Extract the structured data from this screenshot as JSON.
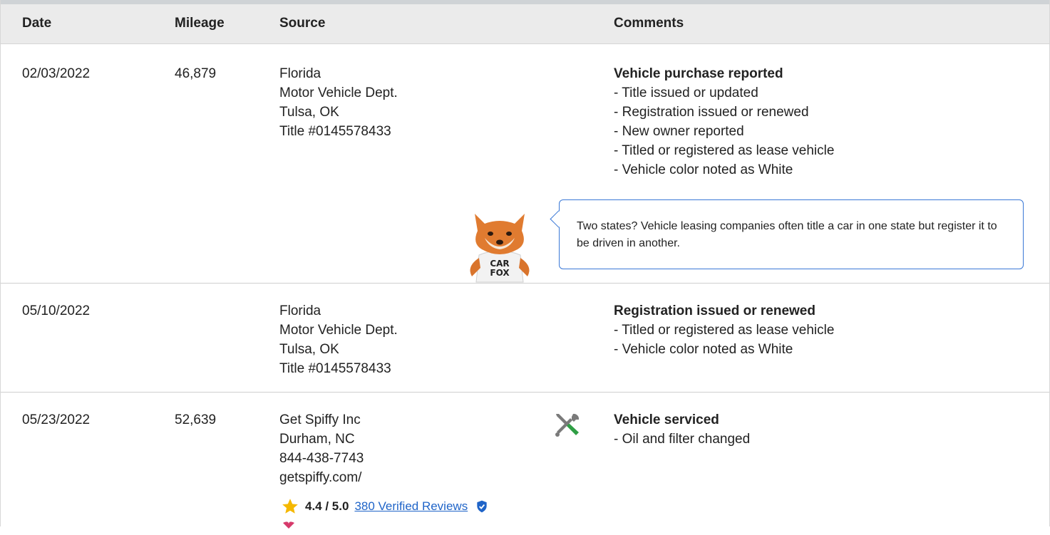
{
  "table": {
    "headers": {
      "date": "Date",
      "mileage": "Mileage",
      "source": "Source",
      "comments": "Comments"
    }
  },
  "rows": [
    {
      "date": "02/03/2022",
      "mileage": "46,879",
      "source": [
        "Florida",
        "Motor Vehicle Dept.",
        "Tulsa, OK",
        "Title #0145578433"
      ],
      "comment_title": "Vehicle purchase reported",
      "comments": [
        "- Title issued or updated",
        "- Registration issued or renewed",
        "- New owner reported",
        "- Titled or registered as lease vehicle",
        "- Vehicle color noted as White"
      ],
      "tip": "Two states? Vehicle leasing companies often title a car in one state but register it to be driven in another.",
      "mascot_label": [
        "CAR",
        "FOX"
      ]
    },
    {
      "date": "05/10/2022",
      "mileage": "",
      "source": [
        "Florida",
        "Motor Vehicle Dept.",
        "Tulsa, OK",
        "Title #0145578433"
      ],
      "comment_title": "Registration issued or renewed",
      "comments": [
        "- Titled or registered as lease vehicle",
        "- Vehicle color noted as White"
      ]
    },
    {
      "date": "05/23/2022",
      "mileage": "52,639",
      "source": [
        "Get Spiffy Inc",
        "Durham, NC",
        "844-438-7743",
        "getspiffy.com/"
      ],
      "comment_title": "Vehicle serviced",
      "comments": [
        "- Oil and filter changed"
      ],
      "rating": {
        "score": "4.4 / 5.0",
        "reviews_link": "380 Verified Reviews"
      },
      "icon": "wrench-screwdriver-icon"
    }
  ],
  "colors": {
    "accent": "#3a78d6",
    "link": "#1f64c8",
    "star": "#f5b800",
    "header_bg": "#ebebeb",
    "service_green": "#2f9e44"
  }
}
